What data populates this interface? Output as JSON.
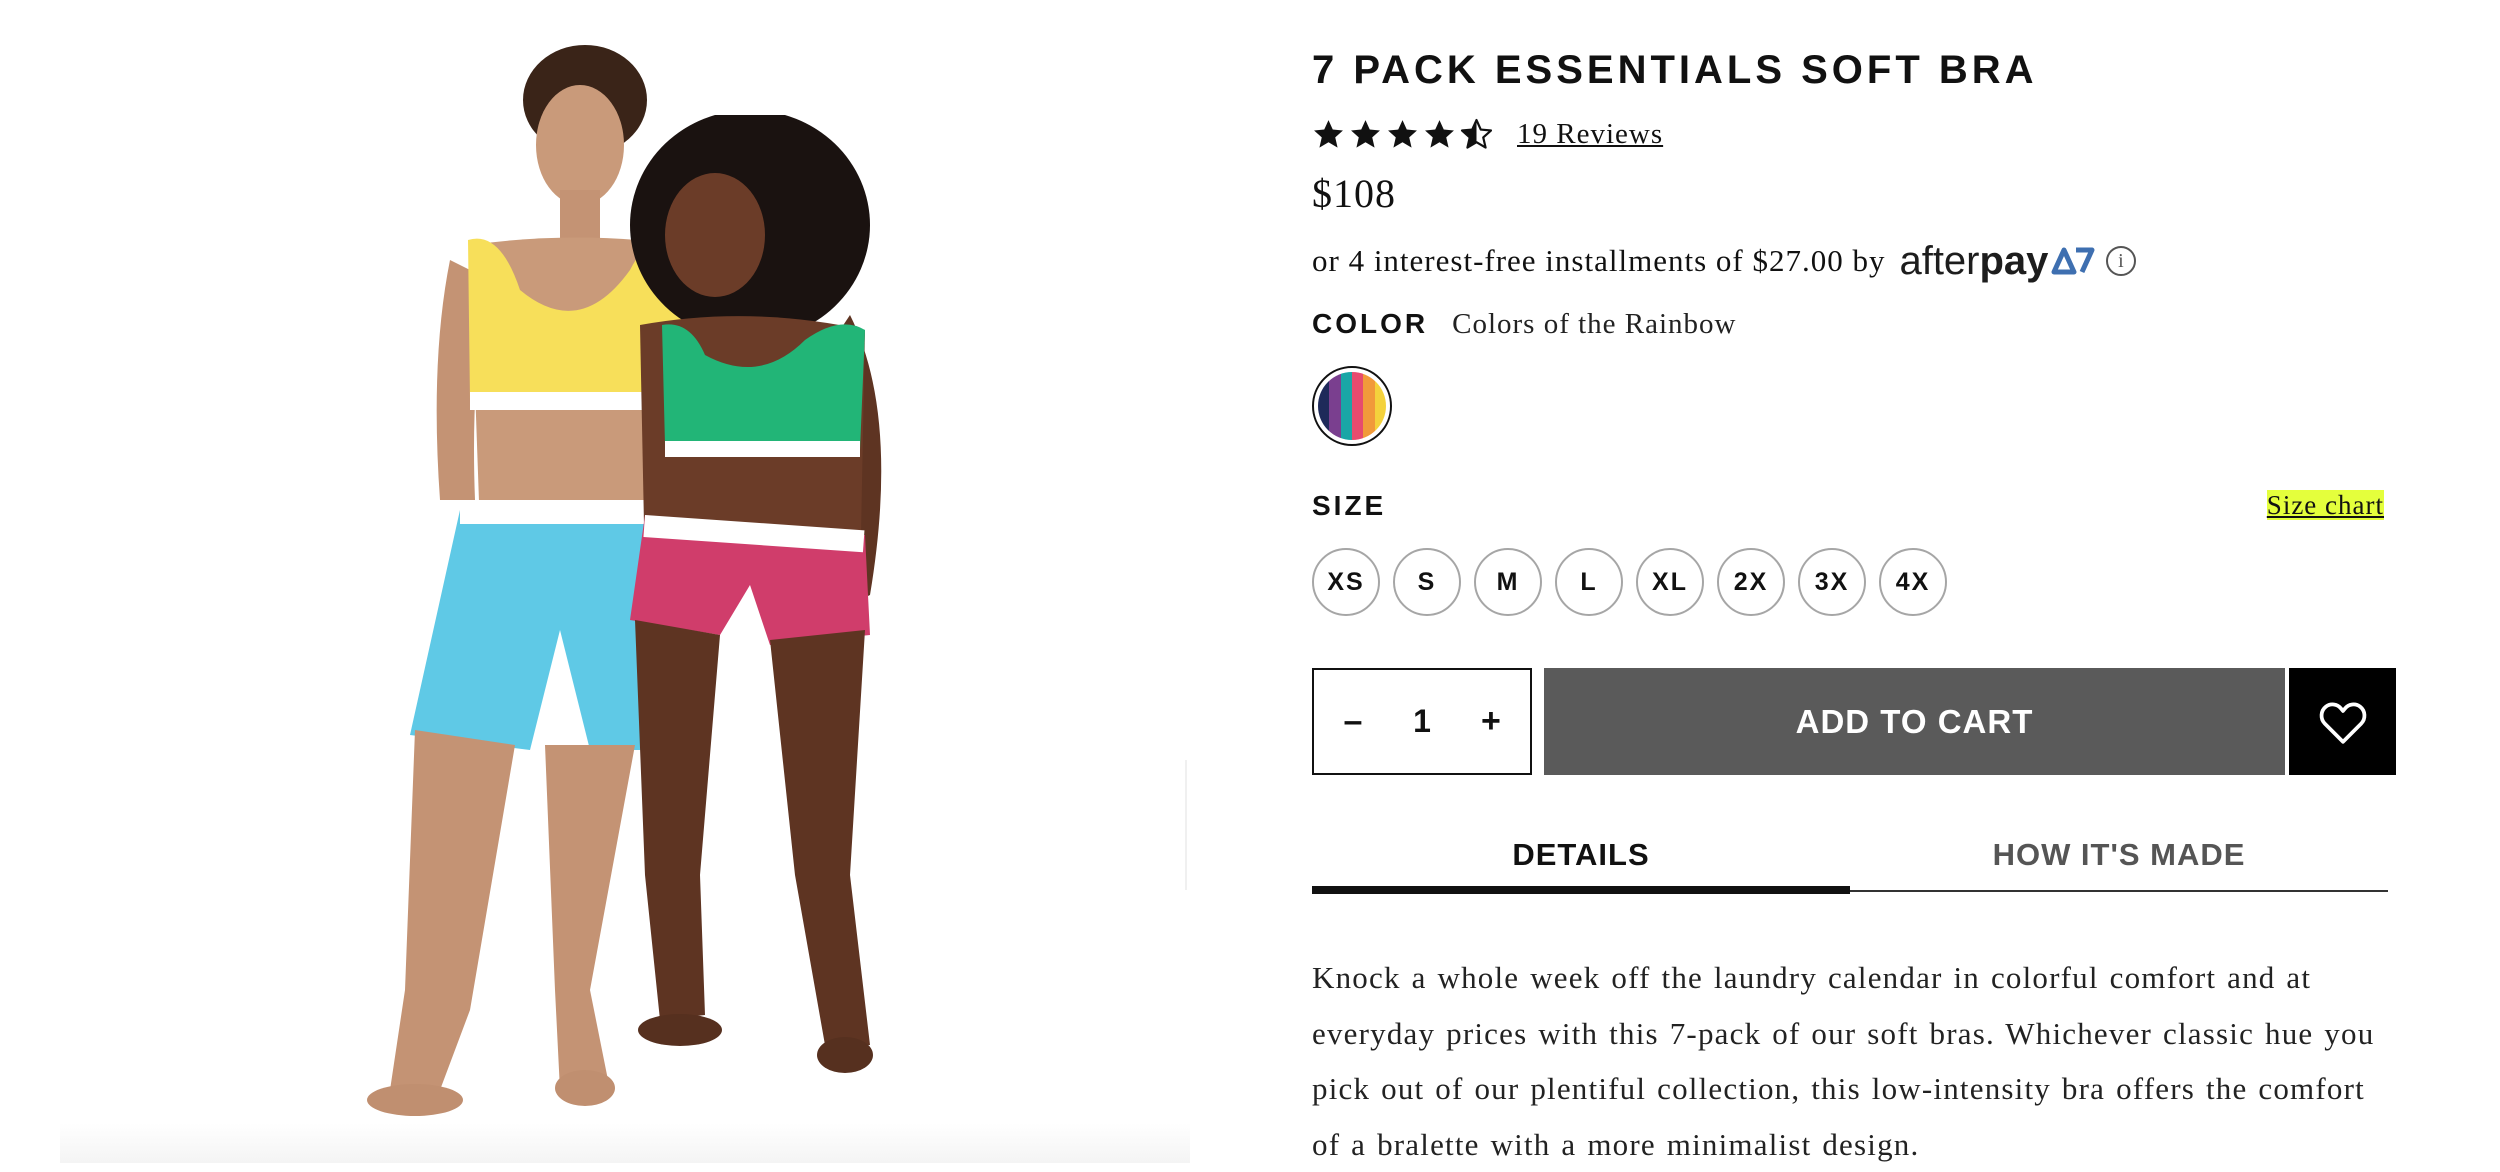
{
  "product": {
    "title": "7 PACK ESSENTIALS SOFT BRA",
    "rating": 4.5,
    "rating_max": 5,
    "reviews_link": "19 Reviews",
    "price": "$108",
    "afterpay": {
      "text": "or 4 interest-free installments of $27.00 by",
      "logo_after": "after",
      "logo_pay": "pay",
      "info_glyph": "i"
    }
  },
  "color": {
    "label": "COLOR",
    "value": "Colors of the Rainbow",
    "swatch_stripes": [
      "#1e2a5a",
      "#7a3f8f",
      "#1aa6a6",
      "#e64b6e",
      "#f19a3a",
      "#f4d23c"
    ]
  },
  "size": {
    "label": "SIZE",
    "chart_link": "Size chart",
    "options": [
      "XS",
      "S",
      "M",
      "L",
      "XL",
      "2X",
      "3X",
      "4X"
    ]
  },
  "cart": {
    "minus": "–",
    "quantity": "1",
    "plus": "+",
    "add_label": "ADD TO CART"
  },
  "tabs": {
    "details": "DETAILS",
    "how_made": "HOW IT'S MADE"
  },
  "description": "Knock a whole week off the laundry calendar in colorful comfort and at everyday prices with this 7-pack of our soft bras. Whichever classic hue you pick out of our plentiful collection, this low-intensity bra offers the comfort of a bralette with a more minimalist design.",
  "colors": {
    "button_gray": "#5a5a5a",
    "highlight": "#e4ff3c",
    "afterpay_blue": "#3e6fb0"
  }
}
